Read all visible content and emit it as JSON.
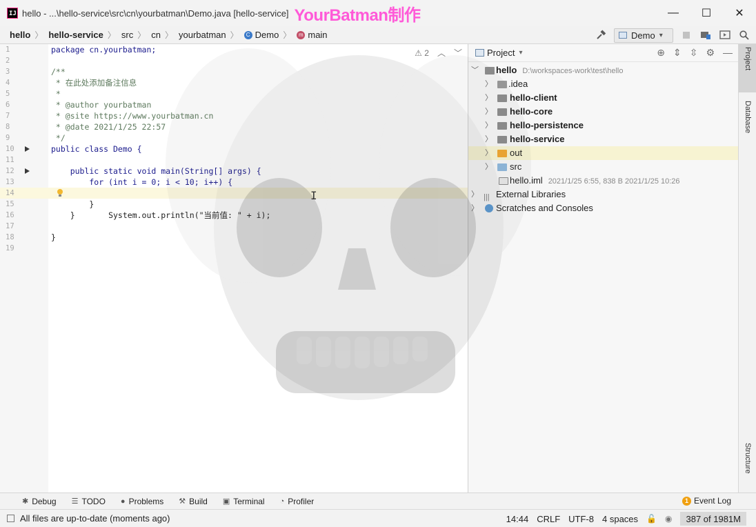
{
  "window": {
    "title": "hello - ...\\hello-service\\src\\cn\\yourbatman\\Demo.java [hello-service]",
    "watermark": "YourBatman制作",
    "app_icon_text": "IJ",
    "minimize": "—",
    "maximize": "☐",
    "close": "✕"
  },
  "breadcrumb": {
    "items": [
      "hello",
      "hello-service",
      "src",
      "cn",
      "yourbatman",
      "Demo",
      "main"
    ],
    "run_config": "Demo"
  },
  "editor": {
    "problems_count": "2",
    "lines": [
      {
        "n": "1",
        "text": "package cn.yourbatman;"
      },
      {
        "n": "2",
        "text": ""
      },
      {
        "n": "3",
        "text": "/**"
      },
      {
        "n": "4",
        "text": " * 在此处添加备注信息"
      },
      {
        "n": "5",
        "text": " *"
      },
      {
        "n": "6",
        "text": " * @author yourbatman"
      },
      {
        "n": "7",
        "text": " * @site https://www.yourbatman.cn"
      },
      {
        "n": "8",
        "text": " * @date 2021/1/25 22:57"
      },
      {
        "n": "9",
        "text": " */"
      },
      {
        "n": "10",
        "text": "public class Demo {"
      },
      {
        "n": "11",
        "text": ""
      },
      {
        "n": "12",
        "text": "    public static void main(String[] args) {"
      },
      {
        "n": "13",
        "text": "        for (int i = 0; i < 10; i++) {"
      },
      {
        "n": "14",
        "text": "            System.out.println(\"当前值: \" + i);"
      },
      {
        "n": "15",
        "text": "        }"
      },
      {
        "n": "16",
        "text": "    }"
      },
      {
        "n": "17",
        "text": ""
      },
      {
        "n": "18",
        "text": "}"
      },
      {
        "n": "19",
        "text": ""
      }
    ]
  },
  "project": {
    "title": "Project",
    "tree": [
      {
        "label": "hello",
        "meta": "D:\\workspaces-work\\test\\hello"
      },
      {
        "label": ".idea",
        "meta": ""
      },
      {
        "label": "hello-client",
        "meta": ""
      },
      {
        "label": "hello-core",
        "meta": ""
      },
      {
        "label": "hello-persistence",
        "meta": ""
      },
      {
        "label": "hello-service",
        "meta": ""
      },
      {
        "label": "out",
        "meta": ""
      },
      {
        "label": "src",
        "meta": ""
      },
      {
        "label": "hello.iml",
        "meta": "2021/1/25 6:55, 838 B 2021/1/25 10:26"
      },
      {
        "label": "External Libraries",
        "meta": ""
      },
      {
        "label": "Scratches and Consoles",
        "meta": ""
      }
    ]
  },
  "side_tabs": {
    "project": "Project",
    "database": "Database",
    "structure": "Structure"
  },
  "tool_windows": {
    "debug": "Debug",
    "todo": "TODO",
    "problems": "Problems",
    "build": "Build",
    "terminal": "Terminal",
    "profiler": "Profiler",
    "event_log": "Event Log",
    "event_count": "1"
  },
  "status": {
    "message": "All files are up-to-date (moments ago)",
    "position": "14:44",
    "line_sep": "CRLF",
    "encoding": "UTF-8",
    "indent": "4 spaces",
    "memory": "387 of 1981M"
  }
}
